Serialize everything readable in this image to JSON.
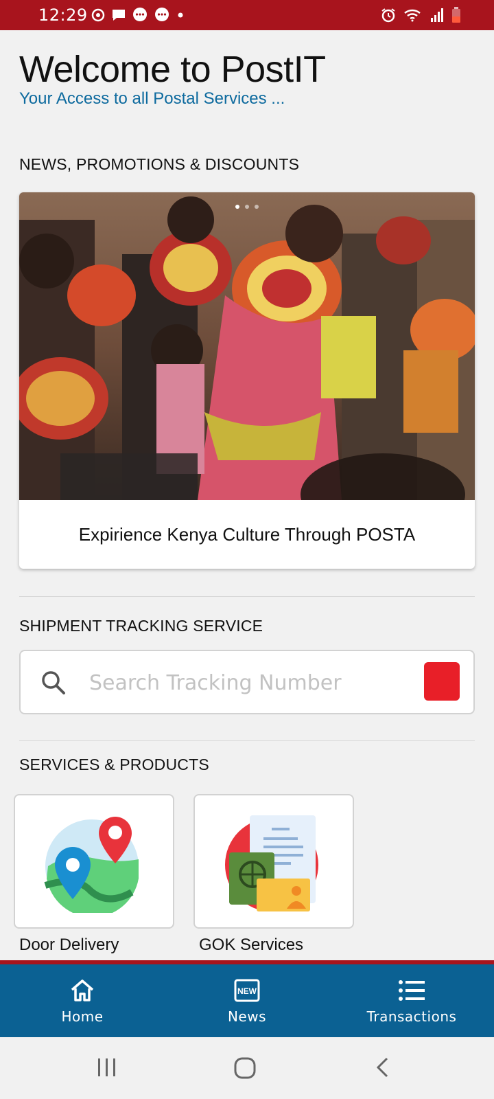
{
  "status_bar": {
    "time": "12:29",
    "left_icons": [
      "sync-icon",
      "message-icon",
      "chat-icon",
      "chat-icon",
      "dot-icon"
    ],
    "right_icons": [
      "alarm-icon",
      "wifi-icon",
      "signal-icon",
      "battery-low-icon"
    ],
    "color": "#a8141d"
  },
  "header": {
    "title": "Welcome to PostIT",
    "tagline": "Your Access to all Postal Services ..."
  },
  "news": {
    "section_title": "NEWS, PROMOTIONS & DISCOUNTS",
    "carousel": {
      "caption": "Expirience Kenya Culture Through POSTA",
      "image": "photo of women in traditional beaded Kenyan attire",
      "slide_count": 3,
      "active_slide": 0
    }
  },
  "tracking": {
    "section_title": "SHIPMENT TRACKING SERVICE",
    "search_placeholder": "Search Tracking Number",
    "search_value": "",
    "button_color": "#e81f28"
  },
  "services": {
    "section_title": "SERVICES & PRODUCTS",
    "items": [
      {
        "label": "Door Delivery",
        "icon": "map-pin-icon"
      },
      {
        "label": "GOK Services",
        "icon": "documents-passport-icon"
      }
    ]
  },
  "bottom_nav": {
    "color": "#0b6193",
    "items": [
      {
        "label": "Home",
        "icon": "home-icon"
      },
      {
        "label": "News",
        "icon": "new-badge-icon"
      },
      {
        "label": "Transactions",
        "icon": "list-icon"
      }
    ]
  },
  "system_nav": {
    "buttons": [
      "recents-icon",
      "home-circle-icon",
      "back-icon"
    ]
  }
}
